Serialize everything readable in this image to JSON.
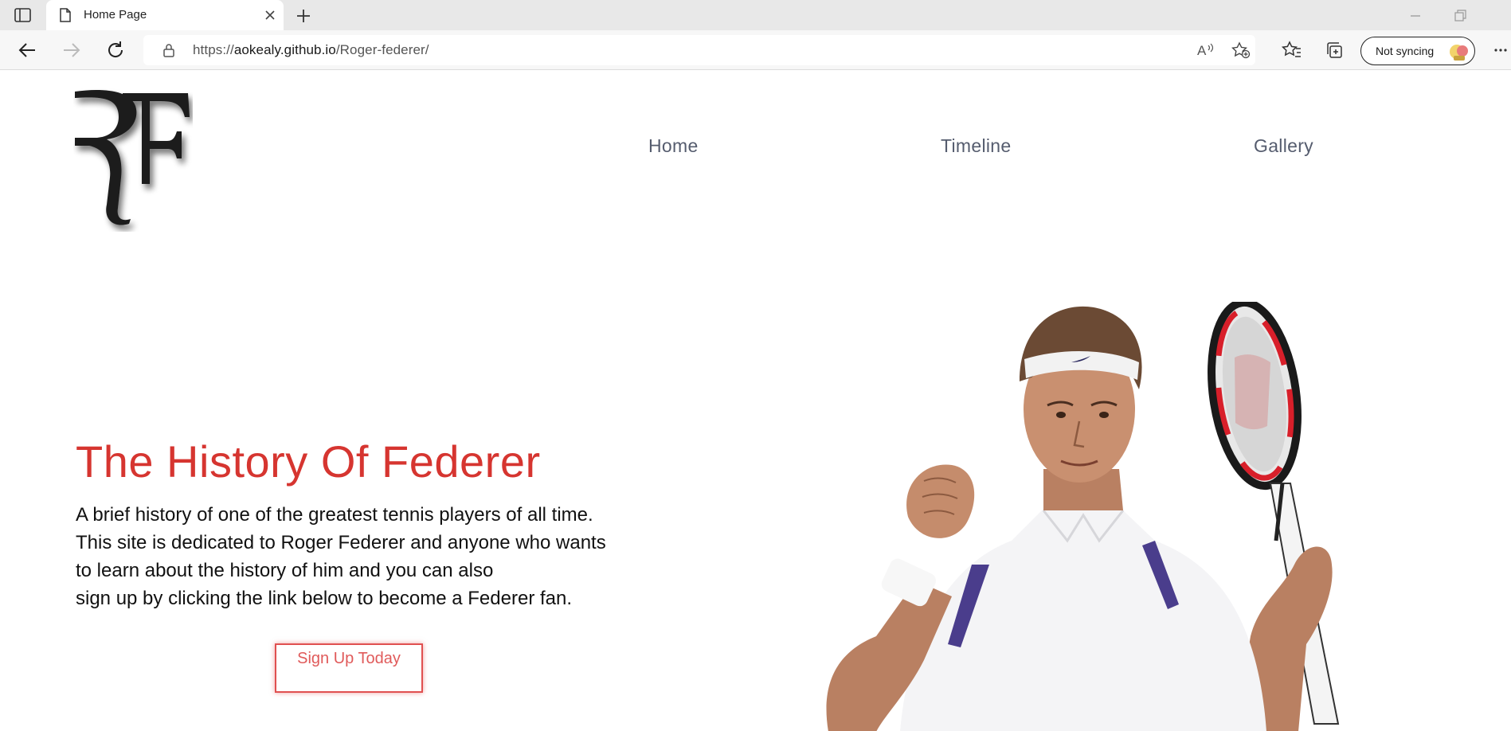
{
  "browser": {
    "tab": {
      "title": "Home Page"
    },
    "address": {
      "scheme": "https://",
      "domain": "aokealy.github.io",
      "path": "/Roger-federer/"
    },
    "sync": {
      "label": "Not syncing"
    }
  },
  "site": {
    "logo_text": "RF",
    "nav": [
      {
        "label": "Home"
      },
      {
        "label": "Timeline"
      },
      {
        "label": "Gallery"
      }
    ],
    "hero": {
      "title": "The History Of Federer",
      "lines": [
        "A brief history of one of the greatest tennis players of all time.",
        "This site is dedicated to Roger Federer and anyone who wants",
        "to learn about the history of him and you can also",
        "sign up by clicking the link below to become a Federer fan."
      ],
      "cta": "Sign Up Today"
    }
  },
  "colors": {
    "accent": "#d63530",
    "button": "#e05050",
    "nav": "#555c6e"
  }
}
